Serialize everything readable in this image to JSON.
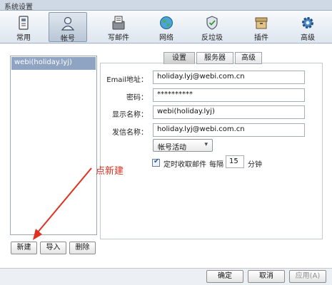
{
  "window": {
    "title": "系统设置"
  },
  "toolbar": {
    "items": [
      {
        "label": "常用",
        "icon": "general-settings-icon"
      },
      {
        "label": "帐号",
        "icon": "account-icon",
        "active": true
      },
      {
        "label": "写邮件",
        "icon": "compose-mail-icon"
      },
      {
        "label": "网络",
        "icon": "globe-icon"
      },
      {
        "label": "反垃圾",
        "icon": "shield-icon"
      },
      {
        "label": "插件",
        "icon": "plugin-box-icon"
      },
      {
        "label": "高级",
        "icon": "gear-icon"
      }
    ]
  },
  "accounts": {
    "items": [
      {
        "label": "webi(holiday.lyj)",
        "selected": true
      }
    ],
    "buttons": {
      "new": "新建",
      "import": "导入",
      "delete": "删除"
    }
  },
  "tabs": [
    {
      "label": "设置",
      "active": true
    },
    {
      "label": "服务器",
      "active": false
    },
    {
      "label": "高级",
      "active": false
    }
  ],
  "form": {
    "email": {
      "label": "Email地址：",
      "value": "holiday.lyj@webi.com.cn"
    },
    "password": {
      "label": "密码：",
      "value": "**********"
    },
    "display_name": {
      "label": "显示名称：",
      "value": "webi(holiday.lyj)"
    },
    "sender_name": {
      "label": "发信名称：",
      "value": "holiday.lyj@webi.com.cn"
    },
    "account_status": {
      "value": "帐号活动"
    },
    "auto_receive": {
      "checked": true,
      "label": "定时收取邮件",
      "prefix": "每隔",
      "interval": "15",
      "unit": "分钟"
    }
  },
  "annotation": {
    "text": "点新建",
    "color": "#e03020"
  },
  "footer": {
    "ok": "确定",
    "cancel": "取消",
    "apply": "应用(A)"
  }
}
